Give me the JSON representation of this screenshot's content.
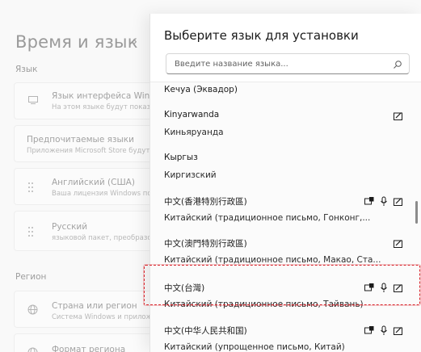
{
  "background": {
    "title": "Время и язык",
    "chevron": "›",
    "section_language": "Язык",
    "section_region": "Регион",
    "cards": [
      {
        "title": "Язык интерфейса Windows",
        "subtitle": "На этом языке будут показаны",
        "icon": "monitor-icon"
      },
      {
        "title": "Предпочитаемые языки",
        "subtitle": "Приложения Microsoft Store будут показаны",
        "icon": ""
      },
      {
        "title": "Английский (США)",
        "subtitle": "Ваша лицензия Windows под",
        "icon": "drag-handle-icon"
      },
      {
        "title": "Русский",
        "subtitle": "языковой пакет, преобразо",
        "icon": "drag-handle-icon"
      },
      {
        "title": "Страна или регион",
        "subtitle": "Система Windows и приложения",
        "icon": "globe-icon"
      },
      {
        "title": "Формат региона",
        "subtitle": "",
        "icon": "globe-icon"
      }
    ]
  },
  "dialog": {
    "title": "Выберите язык для установки",
    "search_placeholder": "Введите название языка...",
    "languages": [
      {
        "name": "Кечуа (Эквадор)",
        "native": "",
        "features": []
      },
      {
        "name": "Kinyarwanda",
        "native": "Киньяруанда",
        "features": [
          "handwriting"
        ]
      },
      {
        "name": "Кыргыз",
        "native": "Киргизский",
        "features": []
      },
      {
        "name": "中文(香港特別行政區)",
        "native": "Китайский (традиционное письмо, Гонконг,...",
        "features": [
          "display",
          "speech",
          "handwriting"
        ]
      },
      {
        "name": "中文(澳門特別行政區)",
        "native": "Китайский (традиционное письмо, Макао, Ста...",
        "features": [
          "handwriting"
        ]
      },
      {
        "name": "中文(台灣)",
        "native": "Китайский (традиционное письмо, Тайвань)",
        "features": [
          "display",
          "speech",
          "handwriting"
        ],
        "selected": true
      },
      {
        "name": "中文(中华人民共和国)",
        "native": "Китайский (упрощенное письмо, Китай)",
        "features": [
          "display",
          "speech",
          "handwriting"
        ]
      }
    ]
  }
}
